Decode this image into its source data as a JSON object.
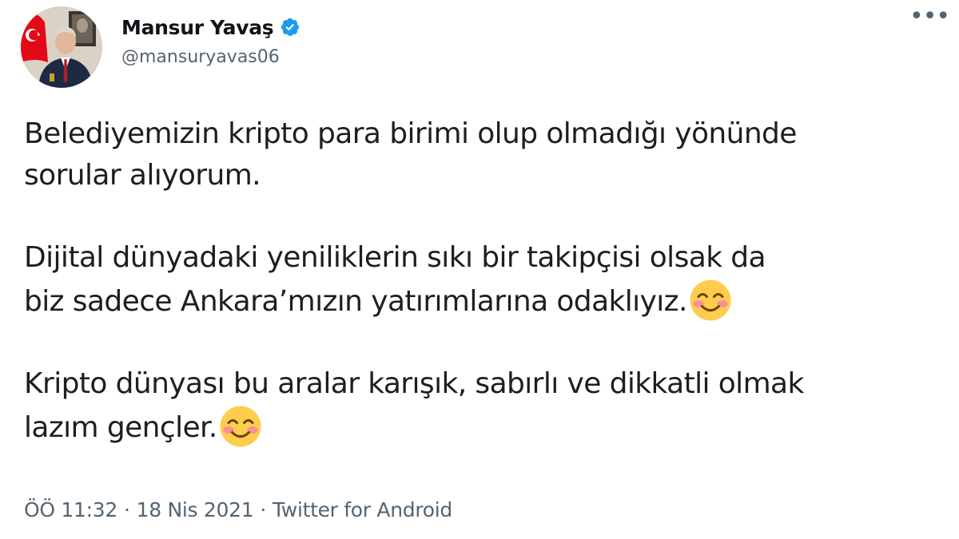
{
  "tweet": {
    "author": {
      "display_name": "Mansur Yavaş",
      "handle": "@mansuryavas06",
      "verified": true,
      "avatar_icon": "profile-photo"
    },
    "paragraphs": [
      [
        "Belediyemizin kripto para birimi olup olmadığı yönünde",
        "sorular alıyorum."
      ],
      [
        "Dijital dünyadaki yeniliklerin sıkı bir takipçisi olsak da",
        "biz sadece Ankara’mızın yatırımlarına odaklıyız."
      ],
      [
        "Kripto dünyası bu aralar karışık, sabırlı ve dikkatli olmak",
        "lazım gençler."
      ]
    ],
    "emoji": "smiling-face-with-smiling-eyes",
    "time": "ÖÖ 11:32",
    "date": "18 Nis 2021",
    "source": "Twitter for Android",
    "more_icon": "ellipsis-icon"
  },
  "colors": {
    "text": "#1c1e21",
    "secondary": "#536471",
    "verified": "#1d9bf0",
    "flag": "#e30a17"
  }
}
